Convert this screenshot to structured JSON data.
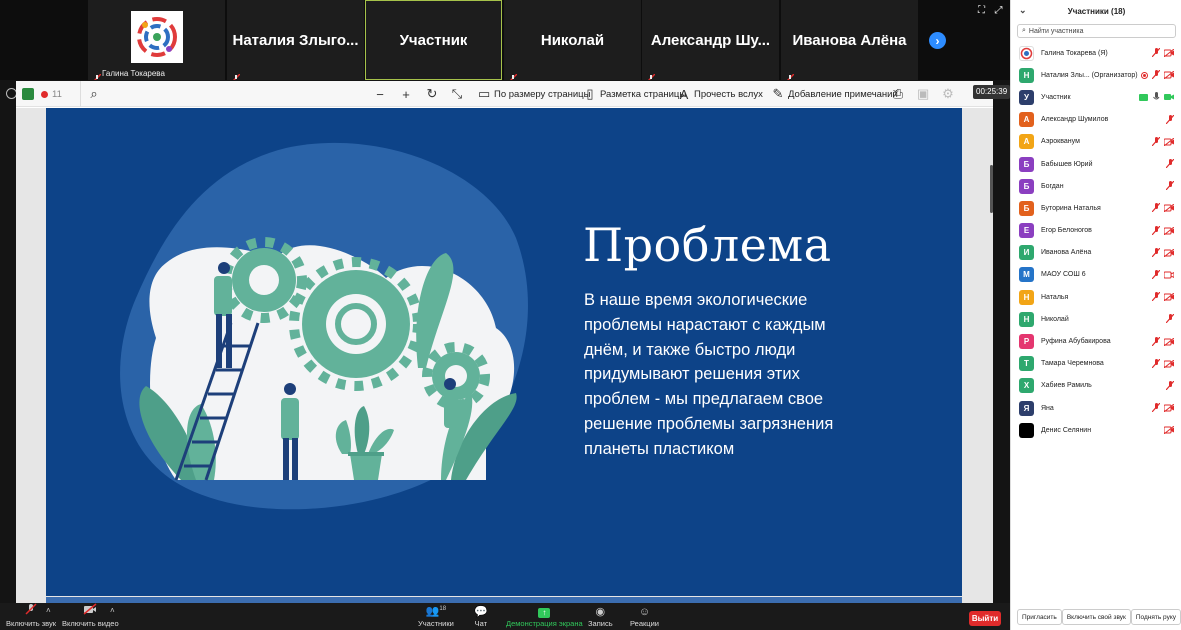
{
  "gallery": {
    "tiles": [
      {
        "name": "",
        "caption": "Галина Токарева",
        "logo": true
      },
      {
        "name": "Наталия  Злыго..."
      },
      {
        "name": "Участник",
        "active": true
      },
      {
        "name": "Николай"
      },
      {
        "name": "Александр  Шу..."
      },
      {
        "name": "Иванова Алёна"
      }
    ],
    "next_icon": "›"
  },
  "toolbar": {
    "page_number": "11",
    "fit_page": "По размеру страницы",
    "page_layout": "Разметка страницы",
    "read_aloud": "Прочесть вслух",
    "add_notes": "Добавление примечаний",
    "timer": "00:25:39"
  },
  "slide": {
    "title": "Проблема",
    "body": "В наше время экологические проблемы нарастают с каждым днём, и также быстро люди придумывают решения  этих проблем - мы предлагаем свое решение проблемы загрязнения планеты пластиком",
    "colors": {
      "background": "#0d4388",
      "blob": "#2a63a8",
      "gear": "#62b29a",
      "plant": "#4e9f89"
    }
  },
  "bottombar": {
    "mic": "Включить звук",
    "video": "Включить видео",
    "participants": "Участники",
    "participants_count": "18",
    "chat": "Чат",
    "share": "Демонстрация экрана",
    "record": "Запись",
    "reactions": "Реакции",
    "leave": "Выйти"
  },
  "panel": {
    "title": "Участники (18)",
    "search_placeholder": "Найти участника",
    "participants": [
      {
        "initial": "",
        "name": "Галина Токарева (Я)",
        "color": "#ffffff",
        "logo": true,
        "mic": "muted",
        "cam": "off"
      },
      {
        "initial": "Н",
        "name": "Наталия Злы...  (Организатор)",
        "color": "#2ea86e",
        "mic": "muted",
        "cam": "off",
        "rec": true
      },
      {
        "initial": "У",
        "name": "Участник",
        "color": "#2d3e6b",
        "mic": "on",
        "cam": "on",
        "share": true
      },
      {
        "initial": "А",
        "name": "Александр Шумилов",
        "color": "#e2611d",
        "mic": "muted",
        "cam": "none"
      },
      {
        "initial": "А",
        "name": "Аэрокванум",
        "color": "#f2a516",
        "mic": "muted",
        "cam": "off"
      },
      {
        "initial": "Б",
        "name": "Бабышев Юрий",
        "color": "#8b3fc0",
        "mic": "muted",
        "cam": "none"
      },
      {
        "initial": "Б",
        "name": "Богдан",
        "color": "#8b3fc0",
        "mic": "muted",
        "cam": "none"
      },
      {
        "initial": "Б",
        "name": "Буторина Наталья",
        "color": "#e2611d",
        "mic": "muted",
        "cam": "off"
      },
      {
        "initial": "Е",
        "name": "Егор Белоногов",
        "color": "#8b3fc0",
        "mic": "muted",
        "cam": "off"
      },
      {
        "initial": "И",
        "name": "Иванова Алёна",
        "color": "#2ea86e",
        "mic": "muted",
        "cam": "off"
      },
      {
        "initial": "М",
        "name": "МАОУ СОШ 6",
        "color": "#2574c8",
        "mic": "muted",
        "cam": "video-off"
      },
      {
        "initial": "Н",
        "name": "Наталья",
        "color": "#f2a516",
        "mic": "muted",
        "cam": "off"
      },
      {
        "initial": "Н",
        "name": "Николай",
        "color": "#2ea86e",
        "mic": "muted",
        "cam": "none"
      },
      {
        "initial": "Р",
        "name": "Руфина Абубакирова",
        "color": "#e4366f",
        "mic": "muted",
        "cam": "off"
      },
      {
        "initial": "Т",
        "name": "Тамара Черемнова",
        "color": "#2ea86e",
        "mic": "muted",
        "cam": "off"
      },
      {
        "initial": "Х",
        "name": "Хабиев Рамиль",
        "color": "#2ea86e",
        "mic": "muted",
        "cam": "none"
      },
      {
        "initial": "Я",
        "name": "Яна",
        "color": "#2d3e6b",
        "mic": "muted",
        "cam": "off"
      },
      {
        "initial": "",
        "name": "Денис Селянин",
        "color": "#000000",
        "mic": "none",
        "cam": "off"
      }
    ],
    "invite": "Пригласить",
    "unmute_me": "Включить свой звук",
    "raise_hand": "Поднять руку"
  }
}
